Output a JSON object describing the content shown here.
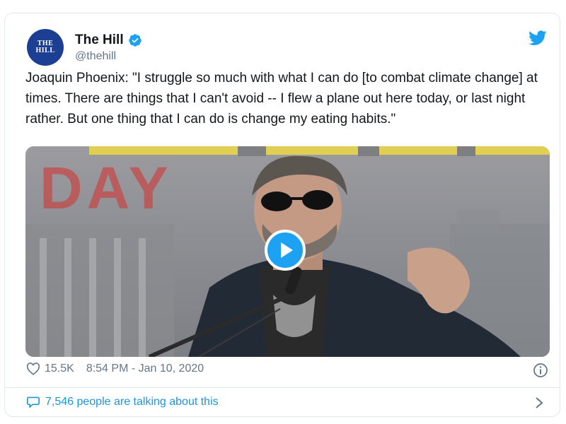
{
  "account": {
    "avatar_line1": "THE",
    "avatar_line2": "HILL",
    "name": "The Hill",
    "handle": "@thehill",
    "verified": true,
    "avatar_color": "#1c3f94"
  },
  "tweet": {
    "text": "Joaquin Phoenix: \"I struggle so much with what I can do [to combat climate change] at times. There are things that I can't avoid -- I flew a plane out here today, or last night rather. But one thing that I can do is change my eating habits.\""
  },
  "media": {
    "banner_text": "DAY",
    "play_icon": "play-icon"
  },
  "stats": {
    "likes": "15.5K",
    "timestamp": "8:54 PM - Jan 10, 2020"
  },
  "footer": {
    "talking_text": "7,546 people are talking about this"
  },
  "colors": {
    "accent": "#1da1f2",
    "link": "#1b95e0",
    "muted": "#657786",
    "border": "#e1e8ed"
  }
}
